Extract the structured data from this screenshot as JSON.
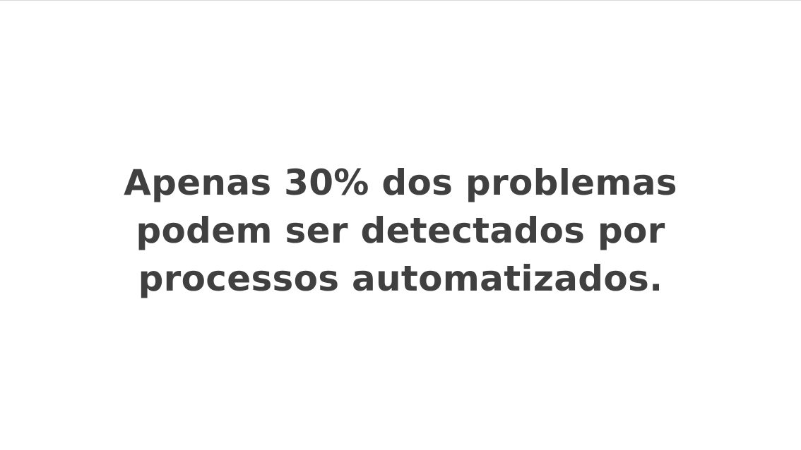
{
  "slide": {
    "statement_lines": [
      "Apenas 30% dos problemas",
      "podem ser detectados por",
      "processos automatizados."
    ],
    "text_color": "#404040",
    "background_color": "#ffffff"
  }
}
